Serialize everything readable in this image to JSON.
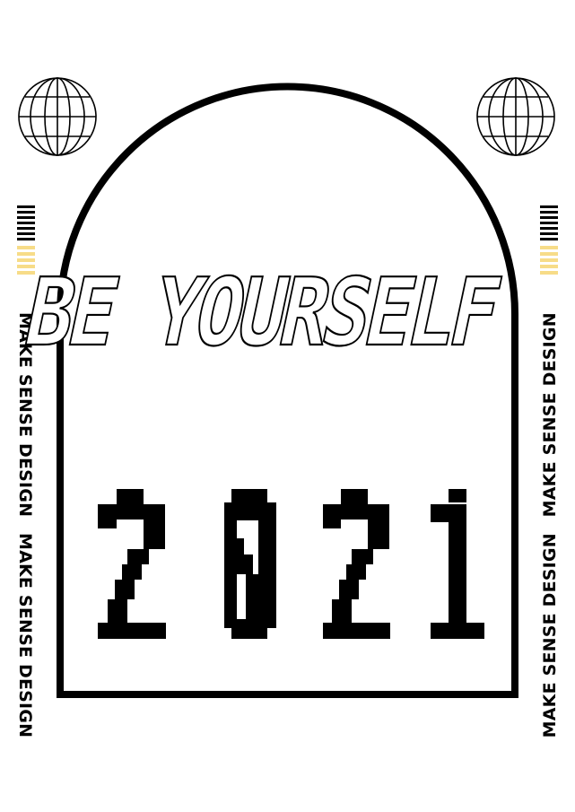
{
  "poster": {
    "headline": "BE YOURSELF",
    "year": "2021",
    "side_text_1": "MAKE SENSE DESIGN",
    "side_text_2": "MAKE SENSE DESIGN",
    "colors": {
      "ink": "#000000",
      "accent": "#f7dc88",
      "background": "#ffffff"
    },
    "icons": [
      "globe-icon",
      "globe-icon"
    ]
  }
}
